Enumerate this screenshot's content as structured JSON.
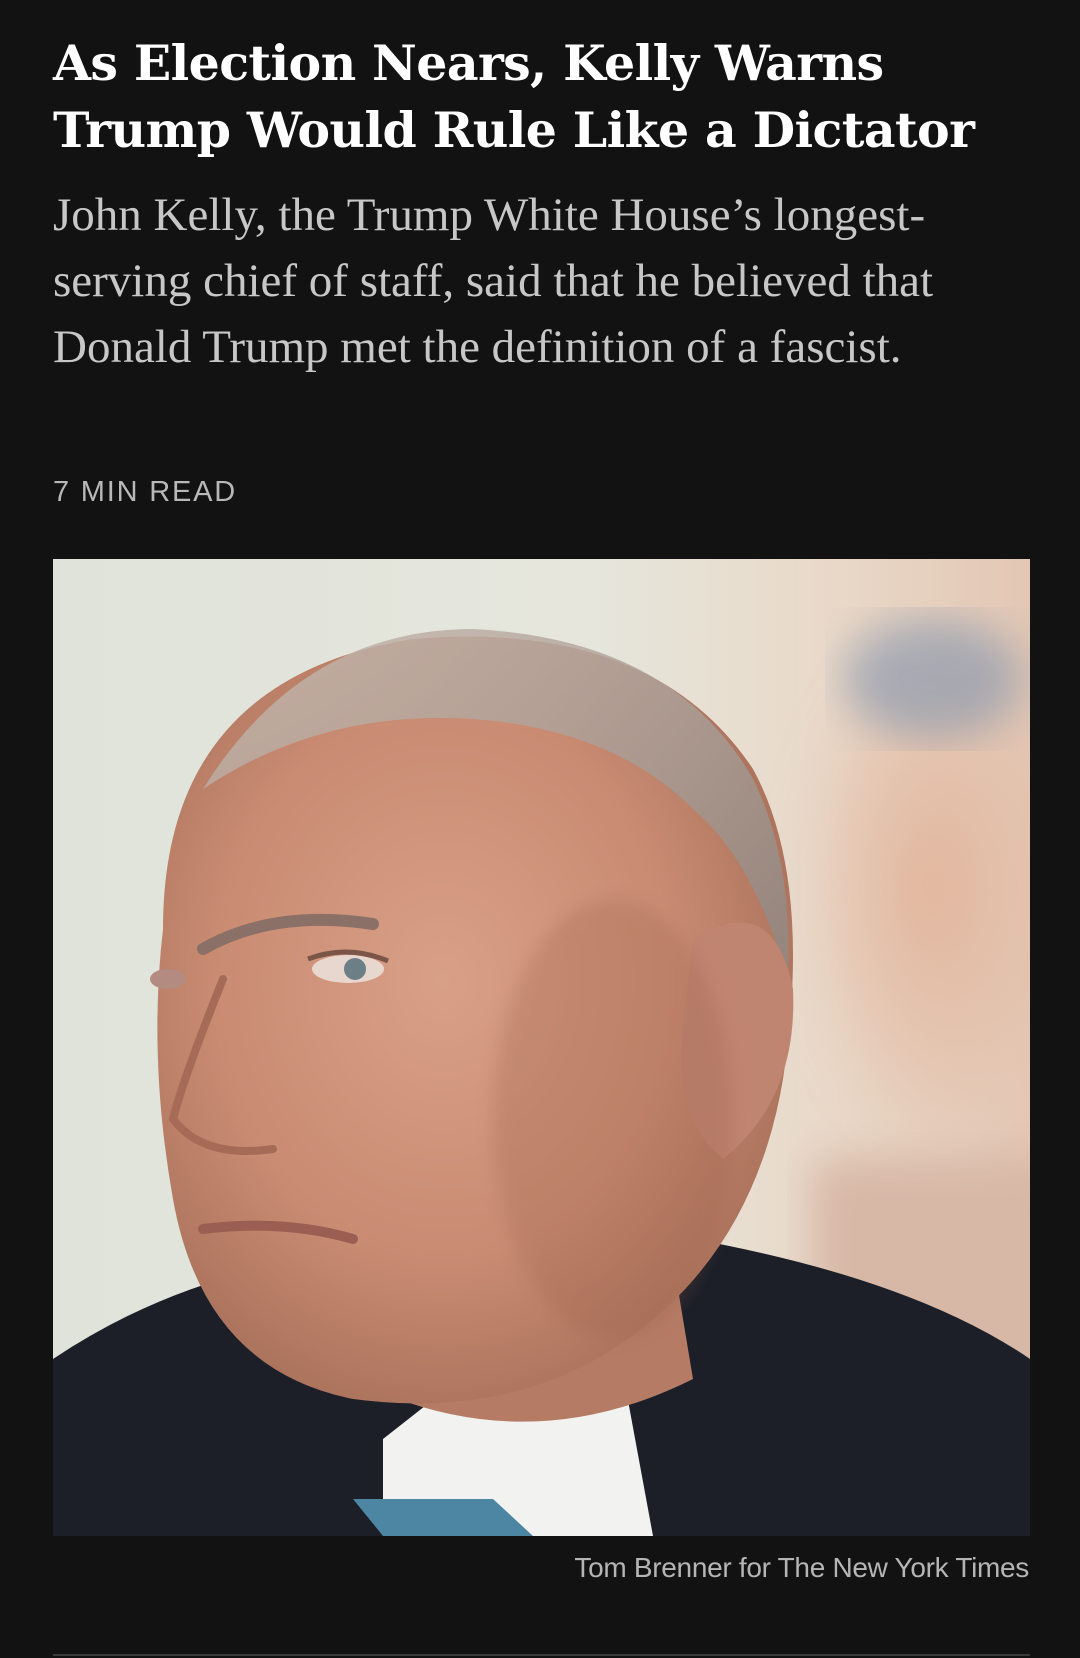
{
  "article": {
    "headline": "As Election Nears, Kelly Warns Trump Would Rule Like a Dictator",
    "summary": "John Kelly, the Trump White House’s longest-serving chief of staff, said that he believed that Donald Trump met the definition of a fascist.",
    "read_time": "7 MIN READ",
    "photo_credit": "Tom Brenner for The New York Times"
  },
  "colors": {
    "background": "#121212",
    "headline": "#ffffff",
    "summary": "#c7c7c7",
    "meta": "#b8b8b8"
  }
}
